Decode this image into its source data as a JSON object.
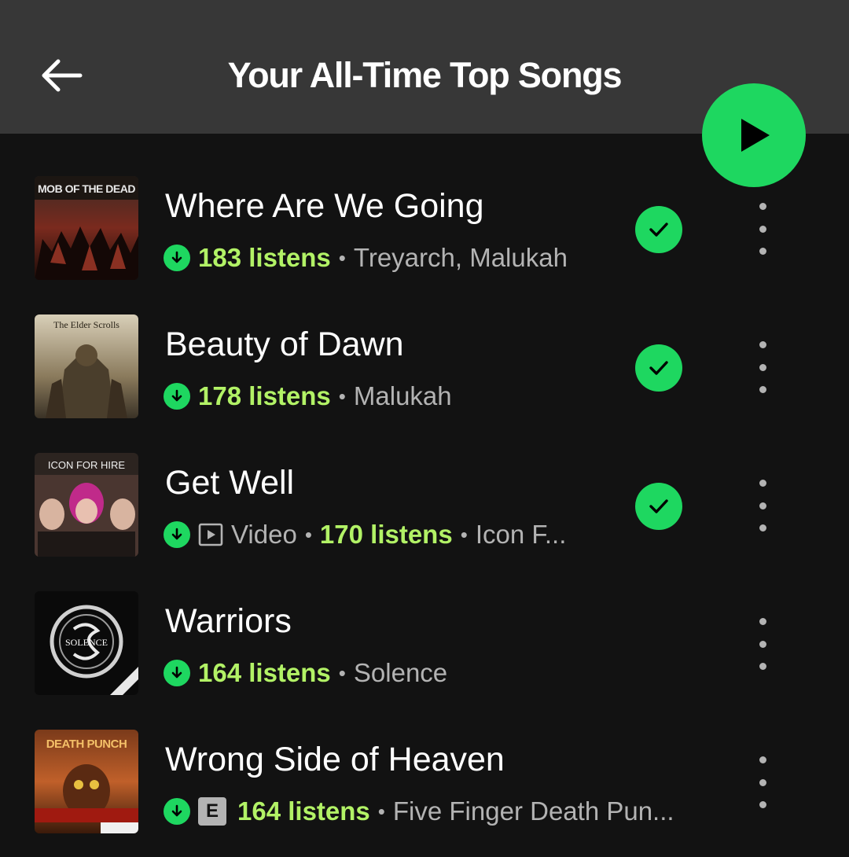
{
  "header": {
    "title": "Your All-Time Top Songs",
    "back_icon": "arrow-left-icon",
    "play_icon": "play-icon"
  },
  "colors": {
    "accent": "#1ed760",
    "listens": "#b2f266",
    "background": "#121212",
    "header": "#373737",
    "secondary_text": "#b3b3b3"
  },
  "songs": [
    {
      "title": "Where Are We Going",
      "listens": "183 listens",
      "artists": "Treyarch, Malukah",
      "downloaded": true,
      "liked": true,
      "art_text": "MOB OF THE DEAD"
    },
    {
      "title": "Beauty of Dawn",
      "listens": "178 listens",
      "artists": "Malukah",
      "downloaded": true,
      "liked": true,
      "art_text": "The Elder Scrolls"
    },
    {
      "title": "Get Well",
      "video_label": "Video",
      "listens": "170 listens",
      "artists": "Icon F...",
      "downloaded": true,
      "liked": true,
      "art_text": "ICON FOR HIRE"
    },
    {
      "title": "Warriors",
      "listens": "164 listens",
      "artists": "Solence",
      "downloaded": true,
      "liked": false,
      "art_text": "SOLENCE"
    },
    {
      "title": "Wrong Side of Heaven",
      "explicit_label": "E",
      "listens": "164 listens",
      "artists": "Five Finger Death Pun...",
      "downloaded": true,
      "liked": false,
      "art_text": "DEATH PUNCH"
    }
  ]
}
